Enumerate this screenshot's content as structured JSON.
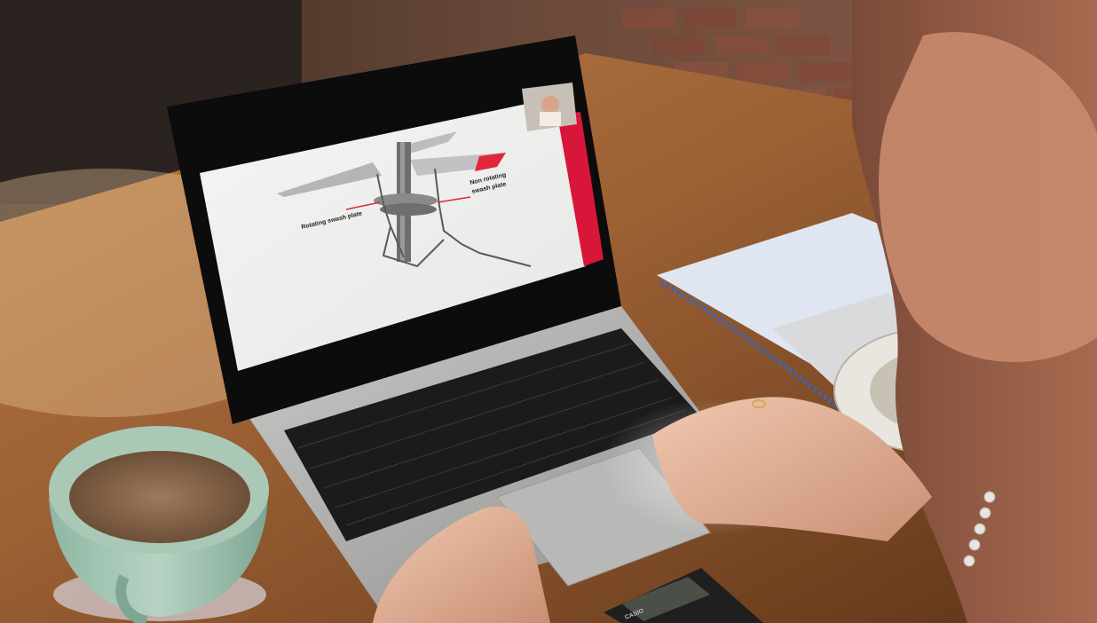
{
  "slide": {
    "label_rotating": "Rotating swash plate",
    "label_non_rotating_line1": "Non rotating",
    "label_non_rotating_line2": "swash plate",
    "accent_color": "#d8163a",
    "blade_tip_color": "#e0283a",
    "hub_highlight_color": "#2a3fd6"
  },
  "calculator": {
    "brand": "CASIO"
  },
  "objects": {
    "laptop": "laptop",
    "mug": "coffee-mug",
    "notebook": "spiral-notebook",
    "flight_computer": "flight-computer"
  }
}
